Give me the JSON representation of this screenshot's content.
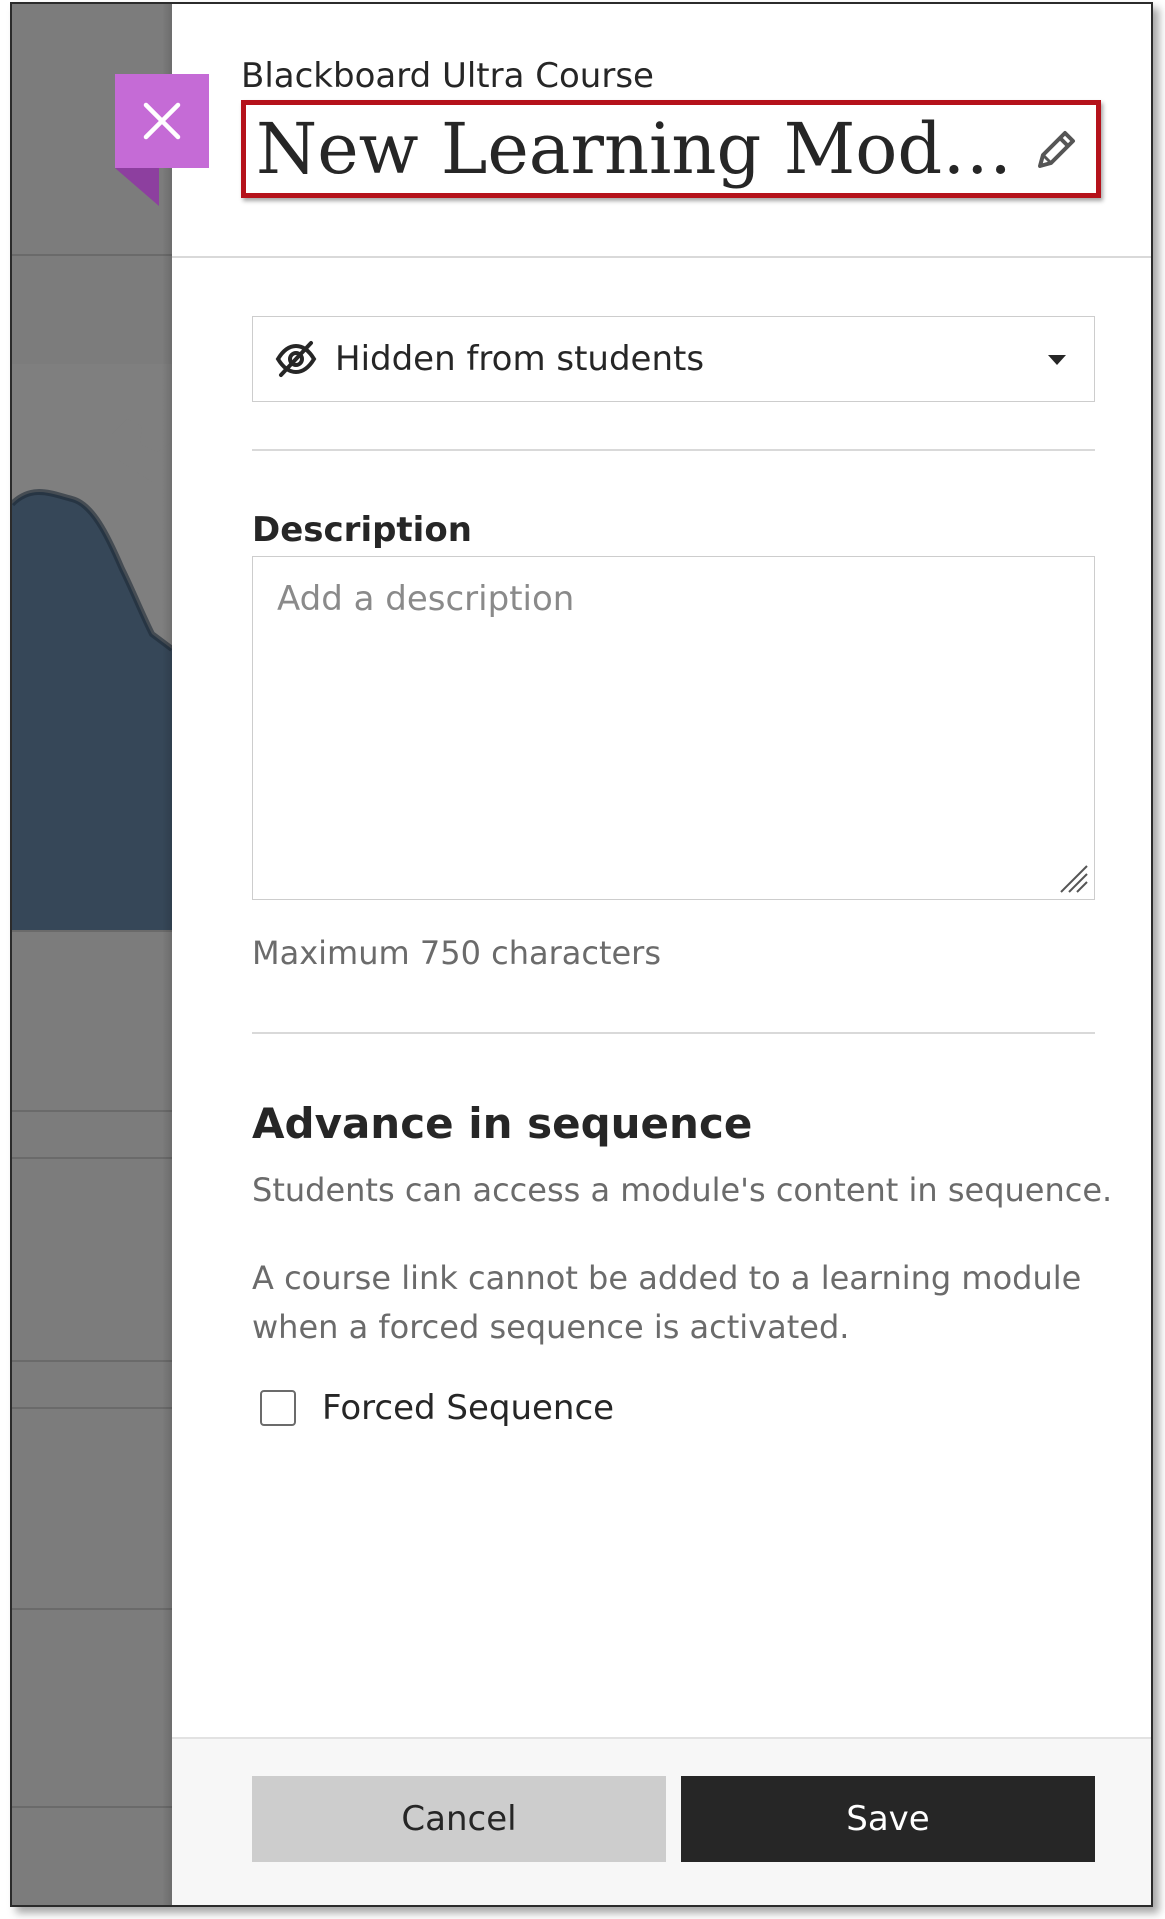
{
  "header": {
    "course_name": "Blackboard Ultra Course",
    "module_title": "New Learning Modul..."
  },
  "icons": {
    "close": "close-icon",
    "edit": "pencil-icon",
    "visibility": "eye-slash-icon",
    "dropdown": "caret-down-icon"
  },
  "visibility": {
    "selected": "Hidden from students"
  },
  "description": {
    "label": "Description",
    "placeholder": "Add a description",
    "value": "",
    "limit_note": "Maximum 750 characters"
  },
  "sequence": {
    "title": "Advance in sequence",
    "desc1": "Students can access a module's content in sequence.",
    "desc2": "A course link cannot be added to a learning module when a forced sequence is activated.",
    "checkbox_label": "Forced Sequence",
    "checked": false
  },
  "footer": {
    "cancel_label": "Cancel",
    "save_label": "Save"
  },
  "colors": {
    "close_tab": "#c56bd6",
    "highlight_border": "#b5121b",
    "save_button": "#262626",
    "cancel_button": "#cdcdcd"
  }
}
